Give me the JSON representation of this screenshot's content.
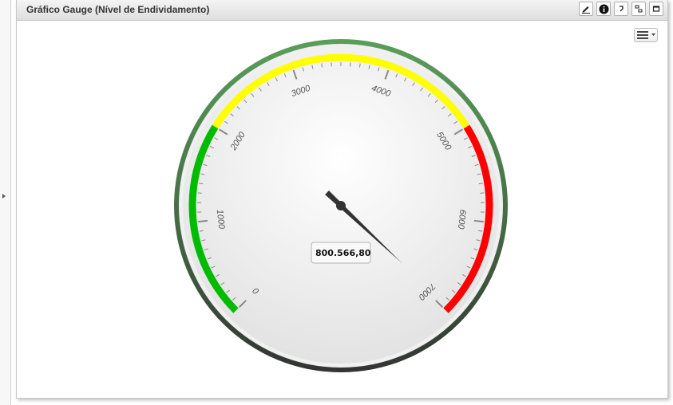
{
  "panel": {
    "title": "Gráfico Gauge (Nível de Endividamento)"
  },
  "toolbar": {
    "edit_icon": "pencil-icon",
    "info_icon": "info-icon",
    "undo_icon": "undo-icon",
    "resize_icon": "resize-icon",
    "maximize_icon": "maximize-icon"
  },
  "chart_menu_icon": "hamburger-menu-icon",
  "chart_data": {
    "type": "gauge",
    "min": 0,
    "max": 7000,
    "major_ticks": [
      0,
      1000,
      2000,
      3000,
      4000,
      5000,
      6000,
      7000
    ],
    "tick_labels": [
      "0",
      "1000",
      "2000",
      "3000",
      "4000",
      "5000",
      "6000",
      "7000"
    ],
    "bands": [
      {
        "from": 0,
        "to": 2000,
        "color": "#00bb00"
      },
      {
        "from": 2000,
        "to": 5000,
        "color": "#ffff00"
      },
      {
        "from": 5000,
        "to": 7000,
        "color": "#ff0000"
      }
    ],
    "value": 800566.8,
    "value_label": "800.566,80",
    "needle_display_value": 7000
  }
}
